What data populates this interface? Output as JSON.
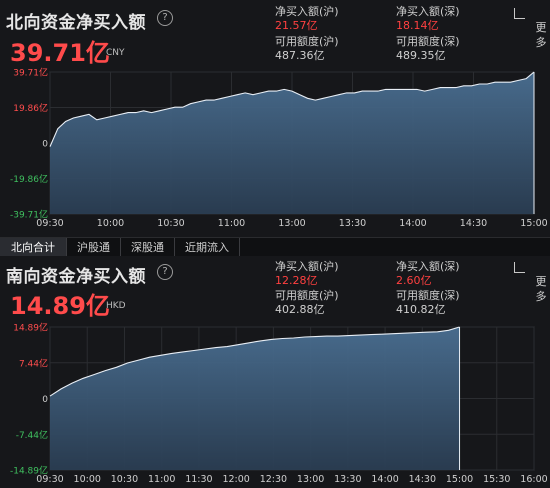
{
  "north": {
    "title": "北向资金净买入额",
    "help": "?",
    "amount": "39.71亿",
    "currency": "CNY",
    "stats": {
      "sh_label": "净买入额(沪)",
      "sh_value": "21.57亿",
      "sz_label": "净买入额(深)",
      "sz_value": "18.14亿",
      "sh_quota_label": "可用额度(沪)",
      "sh_quota_value": "487.36亿",
      "sz_quota_label": "可用额度(深)",
      "sz_quota_value": "489.35亿"
    },
    "side_label": "更\n多",
    "chart_data": {
      "type": "area",
      "yticks": [
        "39.71亿",
        "19.86亿",
        "0",
        "-19.86亿",
        "-39.71亿"
      ],
      "ylim": [
        -39.71,
        39.71
      ],
      "xticks": [
        "09:30",
        "10:00",
        "10:30",
        "11:00",
        "11:30/13:00",
        "13:30",
        "14:00",
        "14:30",
        "15:00"
      ],
      "xtick_labels": [
        "09:30",
        "10:00",
        "10:30",
        "11:00",
        "13:00",
        "13:30",
        "14:00",
        "14:30",
        "15:00"
      ],
      "series": [
        {
          "values": [
            -2,
            8,
            12,
            14,
            15,
            16,
            13,
            14,
            15,
            16,
            17,
            17,
            18,
            17,
            18,
            19,
            20,
            20,
            22,
            23,
            24,
            24,
            25,
            26,
            27,
            28,
            27,
            28,
            29,
            29,
            30,
            29,
            27,
            25,
            24,
            25,
            26,
            27,
            28,
            28,
            29,
            29,
            29,
            30,
            30,
            30,
            30,
            30,
            29,
            30,
            31,
            31,
            31,
            32,
            32,
            33,
            33,
            34,
            34,
            34,
            35,
            36,
            39.71
          ]
        }
      ]
    }
  },
  "tabs": [
    "北向合计",
    "沪股通",
    "深股通",
    "近期流入"
  ],
  "south": {
    "title": "南向资金净买入额",
    "help": "?",
    "amount": "14.89亿",
    "currency": "HKD",
    "stats": {
      "sh_label": "净买入额(沪)",
      "sh_value": "12.28亿",
      "sz_label": "净买入额(深)",
      "sz_value": "2.60亿",
      "sh_quota_label": "可用额度(沪)",
      "sh_quota_value": "402.88亿",
      "sz_quota_label": "可用额度(深)",
      "sz_quota_value": "410.82亿"
    },
    "side_label": "更\n多",
    "chart_data": {
      "type": "area",
      "yticks": [
        "14.89亿",
        "7.44亿",
        "0",
        "-7.44亿",
        "-14.89亿"
      ],
      "ylim": [
        -14.89,
        14.89
      ],
      "xtick_labels": [
        "09:30",
        "10:00",
        "10:30",
        "11:00",
        "11:30",
        "12:00",
        "12:30",
        "13:00",
        "13:30",
        "14:00",
        "14:30",
        "15:00",
        "15:30",
        "16:00"
      ],
      "series": [
        {
          "values": [
            0.5,
            2.0,
            3.2,
            4.2,
            5.0,
            5.8,
            6.5,
            7.4,
            8.0,
            8.6,
            9.0,
            9.4,
            9.7,
            10.0,
            10.3,
            10.6,
            10.8,
            11.2,
            11.6,
            12.0,
            12.3,
            12.5,
            12.6,
            12.8,
            12.9,
            13.0,
            13.0,
            13.1,
            13.2,
            13.3,
            13.4,
            13.5,
            13.6,
            13.7,
            13.8,
            13.9,
            14.2,
            14.89
          ]
        }
      ]
    }
  }
}
